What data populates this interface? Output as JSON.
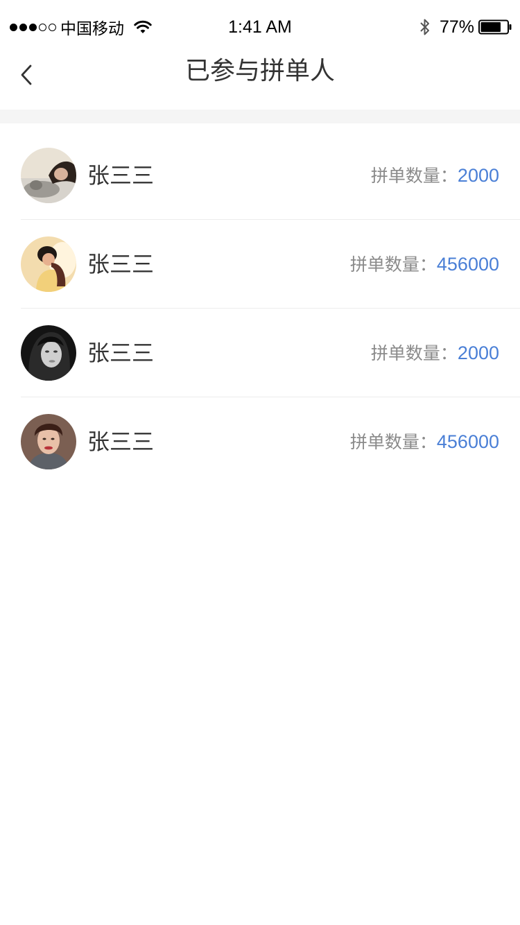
{
  "status_bar": {
    "carrier": "中国移动",
    "time": "1:41 AM",
    "battery_percent": "77%",
    "signal_strength": 3,
    "signal_max": 5,
    "battery_level": 0.77,
    "icons": [
      "wifi-icon",
      "bluetooth-icon",
      "battery-icon"
    ]
  },
  "nav": {
    "title": "已参与拼单人",
    "back_icon": "chevron-left-icon"
  },
  "participants": [
    {
      "name": "张三三",
      "count_label": "拼单数量：",
      "count": "2000",
      "avatar": "avatar-woman-with-cat"
    },
    {
      "name": "张三三",
      "count_label": "拼单数量：",
      "count": "456000",
      "avatar": "avatar-couple"
    },
    {
      "name": "张三三",
      "count_label": "拼单数量：",
      "count": "2000",
      "avatar": "avatar-woman-monochrome"
    },
    {
      "name": "张三三",
      "count_label": "拼单数量：",
      "count": "456000",
      "avatar": "avatar-man-portrait"
    }
  ],
  "colors": {
    "accent": "#4a7fd6",
    "label_gray": "#8a8a8a",
    "text": "#333333",
    "separator": "#f5f5f5"
  }
}
